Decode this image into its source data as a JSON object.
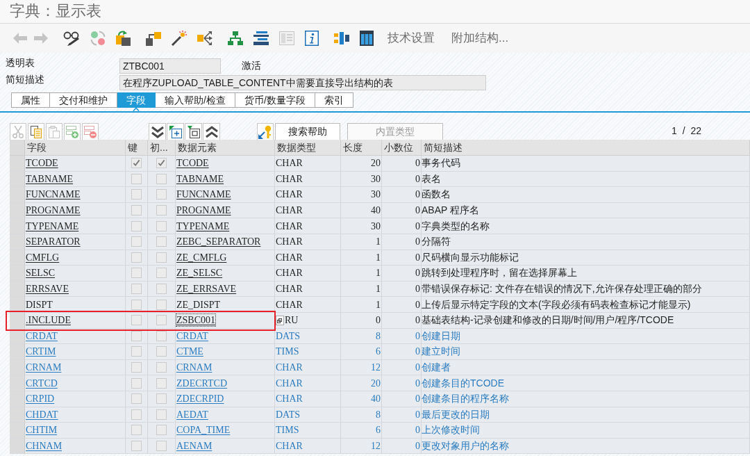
{
  "window": {
    "title": "字典：显示表"
  },
  "toolbar": {
    "buttons": [
      {
        "label": "技术设置"
      },
      {
        "label": "附加结构..."
      }
    ]
  },
  "header_fields": [
    {
      "label": "透明表",
      "value": "ZTBC001",
      "status": "激活"
    },
    {
      "label": "简短描述",
      "value": "在程序ZUPLOAD_TABLE_CONTENT中需要直接导出结构的表"
    }
  ],
  "tabs": [
    {
      "label": "属性",
      "selected": false
    },
    {
      "label": "交付和维护",
      "selected": false
    },
    {
      "label": "字段",
      "selected": true
    },
    {
      "label": "输入帮助/检查",
      "selected": false
    },
    {
      "label": "货币/数量字段",
      "selected": false
    },
    {
      "label": "索引",
      "selected": false
    }
  ],
  "table_toolbar": {
    "buttons": [
      {
        "label": "搜索帮助",
        "disabled": false
      },
      {
        "label": "内置类型",
        "disabled": true
      }
    ],
    "page_info": "1 / 22"
  },
  "table": {
    "columns": [
      "字段",
      "键",
      "初...",
      "数据元素",
      "数据类型",
      "长度",
      "小数位",
      "简短描述"
    ],
    "rows": [
      {
        "field": "TCODE",
        "key": true,
        "initial": true,
        "data_element": "TCODE",
        "data_type": "CHAR",
        "length": "20",
        "decimals": "0",
        "description": "事务代码",
        "kind": "field",
        "linked": true,
        "highlighted": false,
        "focused": false
      },
      {
        "field": "TABNAME",
        "key": false,
        "initial": false,
        "data_element": "TABNAME",
        "data_type": "CHAR",
        "length": "30",
        "decimals": "0",
        "description": "表名",
        "kind": "field",
        "linked": true,
        "highlighted": false,
        "focused": false
      },
      {
        "field": "FUNCNAME",
        "key": false,
        "initial": false,
        "data_element": "FUNCNAME",
        "data_type": "CHAR",
        "length": "30",
        "decimals": "0",
        "description": "函数名",
        "kind": "field",
        "linked": true,
        "highlighted": false,
        "focused": false
      },
      {
        "field": "PROGNAME",
        "key": false,
        "initial": false,
        "data_element": "PROGNAME",
        "data_type": "CHAR",
        "length": "40",
        "decimals": "0",
        "description": "ABAP 程序名",
        "kind": "field",
        "linked": true,
        "highlighted": false,
        "focused": false
      },
      {
        "field": "TYPENAME",
        "key": false,
        "initial": false,
        "data_element": "TYPENAME",
        "data_type": "CHAR",
        "length": "30",
        "decimals": "0",
        "description": "字典类型的名称",
        "kind": "field",
        "linked": true,
        "highlighted": false,
        "focused": false
      },
      {
        "field": "SEPARATOR",
        "key": false,
        "initial": false,
        "data_element": "ZEBC_SEPARATOR",
        "data_type": "CHAR",
        "length": "1",
        "decimals": "0",
        "description": "分隔符",
        "kind": "field",
        "linked": true,
        "highlighted": false,
        "focused": false
      },
      {
        "field": "CMFLG",
        "key": false,
        "initial": false,
        "data_element": "ZE_CMFLG",
        "data_type": "CHAR",
        "length": "1",
        "decimals": "0",
        "description": "尺码横向显示功能标记",
        "kind": "field",
        "linked": true,
        "highlighted": false,
        "focused": false
      },
      {
        "field": "SELSC",
        "key": false,
        "initial": false,
        "data_element": "ZE_SELSC",
        "data_type": "CHAR",
        "length": "1",
        "decimals": "0",
        "description": "跳转到处理程序时，留在选择屏幕上",
        "kind": "field",
        "linked": true,
        "highlighted": false,
        "focused": false
      },
      {
        "field": "ERRSAVE",
        "key": false,
        "initial": false,
        "data_element": "ZE_ERRSAVE",
        "data_type": "CHAR",
        "length": "1",
        "decimals": "0",
        "description": "带错误保存标记: 文件存在错误的情况下,允许保存处理正确的部分",
        "kind": "field",
        "linked": true,
        "highlighted": false,
        "focused": false
      },
      {
        "field": "DISPT",
        "key": false,
        "initial": false,
        "data_element": "ZE_DISPT",
        "data_type": "CHAR",
        "length": "1",
        "decimals": "0",
        "description": "上传后显示特定字段的文本(字段必须有码表检查标记才能显示)",
        "kind": "field",
        "linked": false,
        "highlighted": false,
        "focused": false
      },
      {
        "field": ".INCLUDE",
        "key": false,
        "initial": false,
        "data_element": "ZSBC001",
        "data_type": "RU",
        "length": "0",
        "decimals": "0",
        "description": "基础表结构-记录创建和修改的日期/时间/用户/程序/TCODE",
        "kind": "field",
        "linked": true,
        "highlighted": true,
        "focused": true
      },
      {
        "field": "CRDAT",
        "key": false,
        "initial": false,
        "data_element": "CRDAT",
        "data_type": "DATS",
        "length": "8",
        "decimals": "0",
        "description": "创建日期",
        "kind": "included",
        "linked": true,
        "highlighted": false,
        "focused": false
      },
      {
        "field": "CRTIM",
        "key": false,
        "initial": false,
        "data_element": "CTME",
        "data_type": "TIMS",
        "length": "6",
        "decimals": "0",
        "description": "建立时间",
        "kind": "included",
        "linked": true,
        "highlighted": false,
        "focused": false
      },
      {
        "field": "CRNAM",
        "key": false,
        "initial": false,
        "data_element": "CRNAM",
        "data_type": "CHAR",
        "length": "12",
        "decimals": "0",
        "description": "创建者",
        "kind": "included",
        "linked": true,
        "highlighted": false,
        "focused": false
      },
      {
        "field": "CRTCD",
        "key": false,
        "initial": false,
        "data_element": "ZDECRTCD",
        "data_type": "CHAR",
        "length": "20",
        "decimals": "0",
        "description": "创建条目的TCODE",
        "kind": "included",
        "linked": true,
        "highlighted": false,
        "focused": false
      },
      {
        "field": "CRPID",
        "key": false,
        "initial": false,
        "data_element": "ZDECRPID",
        "data_type": "CHAR",
        "length": "40",
        "decimals": "0",
        "description": "创建条目的程序名称",
        "kind": "included",
        "linked": true,
        "highlighted": false,
        "focused": false
      },
      {
        "field": "CHDAT",
        "key": false,
        "initial": false,
        "data_element": "AEDAT",
        "data_type": "DATS",
        "length": "8",
        "decimals": "0",
        "description": "最后更改的日期",
        "kind": "included",
        "linked": true,
        "highlighted": false,
        "focused": false
      },
      {
        "field": "CHTIM",
        "key": false,
        "initial": false,
        "data_element": "COPA_TIME",
        "data_type": "TIMS",
        "length": "6",
        "decimals": "0",
        "description": "上次修改时间",
        "kind": "included",
        "linked": true,
        "highlighted": false,
        "focused": false
      },
      {
        "field": "CHNAM",
        "key": false,
        "initial": false,
        "data_element": "AENAM",
        "data_type": "CHAR",
        "length": "12",
        "decimals": "0",
        "description": "更改对象用户的名称",
        "kind": "included",
        "linked": true,
        "highlighted": false,
        "focused": false
      }
    ]
  }
}
